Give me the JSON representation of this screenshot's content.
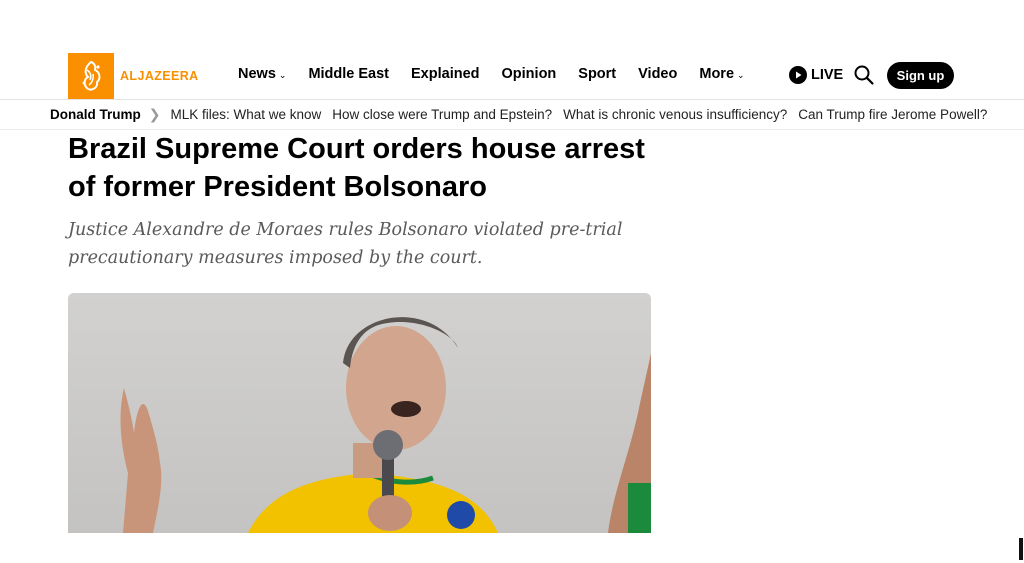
{
  "brand": {
    "name": "ALJAZEERA",
    "accent_color": "#fa9000",
    "logo_icon": "aljazeera-calligraphy-logo"
  },
  "nav": {
    "items": [
      {
        "label": "News",
        "has_dropdown": true
      },
      {
        "label": "Middle East",
        "has_dropdown": false
      },
      {
        "label": "Explained",
        "has_dropdown": false
      },
      {
        "label": "Opinion",
        "has_dropdown": false
      },
      {
        "label": "Sport",
        "has_dropdown": false
      },
      {
        "label": "Video",
        "has_dropdown": false
      },
      {
        "label": "More",
        "has_dropdown": true
      }
    ],
    "live_label": "LIVE",
    "live_icon": "play-icon",
    "search_icon": "search-icon",
    "signup_label": "Sign up"
  },
  "trending": {
    "title": "Donald Trump",
    "separator_icon": "chevron-right-icon",
    "items": [
      "MLK files: What we know",
      "How close were Trump and Epstein?",
      "What is chronic venous insufficiency?",
      "Can Trump fire Jerome Powell?"
    ]
  },
  "article": {
    "headline": "Brazil Supreme Court orders house arrest of former President Bolsonaro",
    "subheading": "Justice Alexandre de Moraes rules Bolsonaro violated pre-trial precautionary measures imposed by the court."
  }
}
